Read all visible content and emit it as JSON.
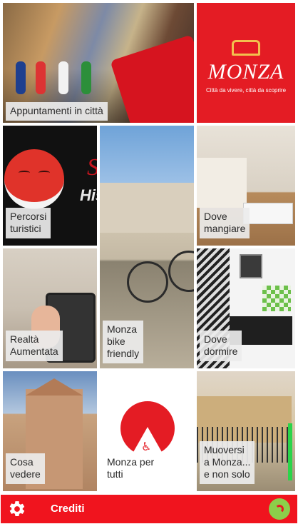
{
  "tiles": {
    "appointments": {
      "label": "Appuntamenti in città"
    },
    "logo": {
      "brand": "MONZA",
      "tagline": "Città da vivere, città da scoprire"
    },
    "tourist_routes": {
      "label": "Percorsi\nturistici",
      "photo_text": "His"
    },
    "bike": {
      "label": "Monza\nbike\nfriendly"
    },
    "dining": {
      "label": "Dove\nmangiare"
    },
    "augmented_reality": {
      "label": "Realtà\nAumentata"
    },
    "sleeping": {
      "label": "Dove\ndormire"
    },
    "see": {
      "label": "Cosa\nvedere"
    },
    "accessibility": {
      "label": "Monza per\ntutti"
    },
    "transport": {
      "label": "Muoversi\na Monza...\ne non solo"
    }
  },
  "footer": {
    "settings_icon": "gear-icon",
    "credits_label": "Crediti",
    "network_icon": "satellite-dish-icon"
  },
  "colors": {
    "brand_red": "#e41c24",
    "footer_red": "#f0141e",
    "label_bg": "#ebebeb"
  }
}
